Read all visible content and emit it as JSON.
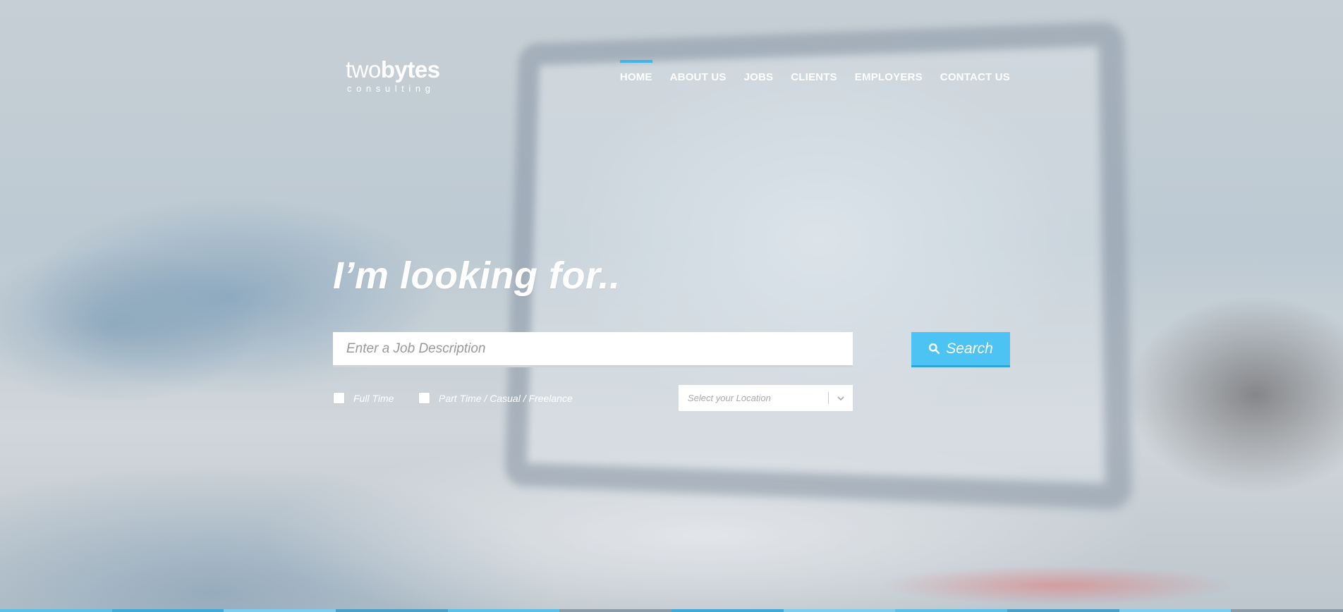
{
  "brand": {
    "name_light": "two",
    "name_bold": "bytes",
    "tagline": "consulting"
  },
  "nav": {
    "items": [
      {
        "label": "HOME",
        "active": true
      },
      {
        "label": "ABOUT US"
      },
      {
        "label": "JOBS"
      },
      {
        "label": "CLIENTS"
      },
      {
        "label": "EMPLOYERS"
      },
      {
        "label": "CONTACT US"
      }
    ]
  },
  "hero": {
    "headline": "I’m looking for..",
    "search": {
      "placeholder": "Enter a Job Description",
      "value": "",
      "button_label": "Search",
      "button_icon": "search-icon"
    },
    "filters": {
      "full_time_label": "Full Time",
      "full_time_checked": false,
      "part_time_label": "Part Time / Casual / Freelance",
      "part_time_checked": false,
      "location_placeholder": "Select your Location"
    }
  },
  "colors": {
    "accent": "#4cc3f3",
    "accent_dark": "#2ea4d8",
    "nav_active": "#3fb4e6",
    "text_on_image": "#ffffff"
  }
}
